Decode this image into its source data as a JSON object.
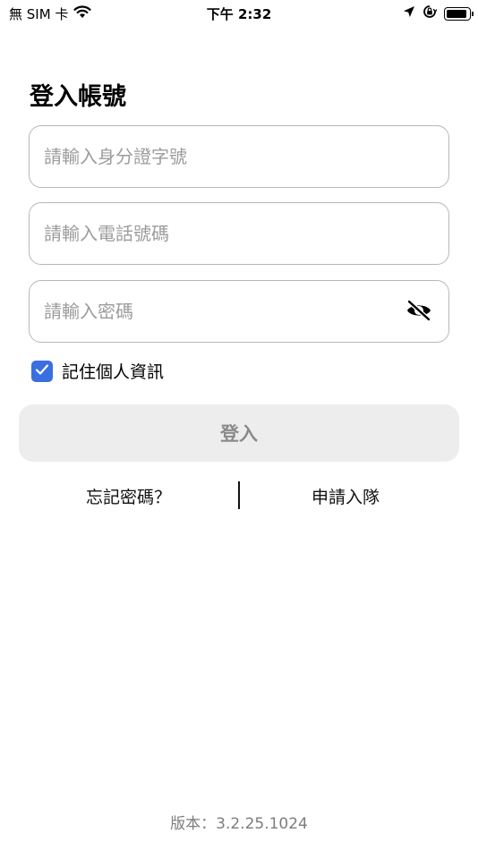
{
  "status_bar": {
    "carrier": "無 SIM 卡",
    "time": "下午 2:32",
    "icons": [
      "wifi-icon",
      "location-arrow-icon",
      "orientation-lock-icon",
      "battery-icon"
    ]
  },
  "login": {
    "title": "登入帳號",
    "id_placeholder": "請輸入身分證字號",
    "phone_placeholder": "請輸入電話號碼",
    "password_placeholder": "請輸入密碼",
    "password_toggle_icon": "eye-off-icon",
    "remember_label": "記住個人資訊",
    "remember_checked": true,
    "submit_label": "登入"
  },
  "links": {
    "forgot": "忘記密碼？",
    "apply": "申請入隊"
  },
  "footer": {
    "version": "版本：3.2.25.1024"
  },
  "colors": {
    "accent": "#3a6fe0",
    "button_bg": "#ededed",
    "button_text": "#8a8a8a",
    "placeholder": "#9c9c9c",
    "border": "#b8b8b8"
  }
}
